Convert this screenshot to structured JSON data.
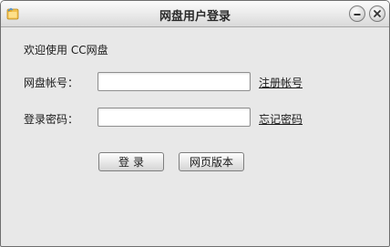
{
  "window": {
    "title": "网盘用户登录",
    "icon": "folder-icon",
    "controls": [
      "minimize-icon",
      "close-icon"
    ]
  },
  "welcome_text": "欢迎使用 CC网盘",
  "form": {
    "account_label": "网盘帐号：",
    "account_value": "",
    "password_label": "登录密码：",
    "password_value": ""
  },
  "links": {
    "register": "注册帐号",
    "forgot_password": "忘记密码"
  },
  "buttons": {
    "login": "登录",
    "web_version": "网页版本"
  }
}
